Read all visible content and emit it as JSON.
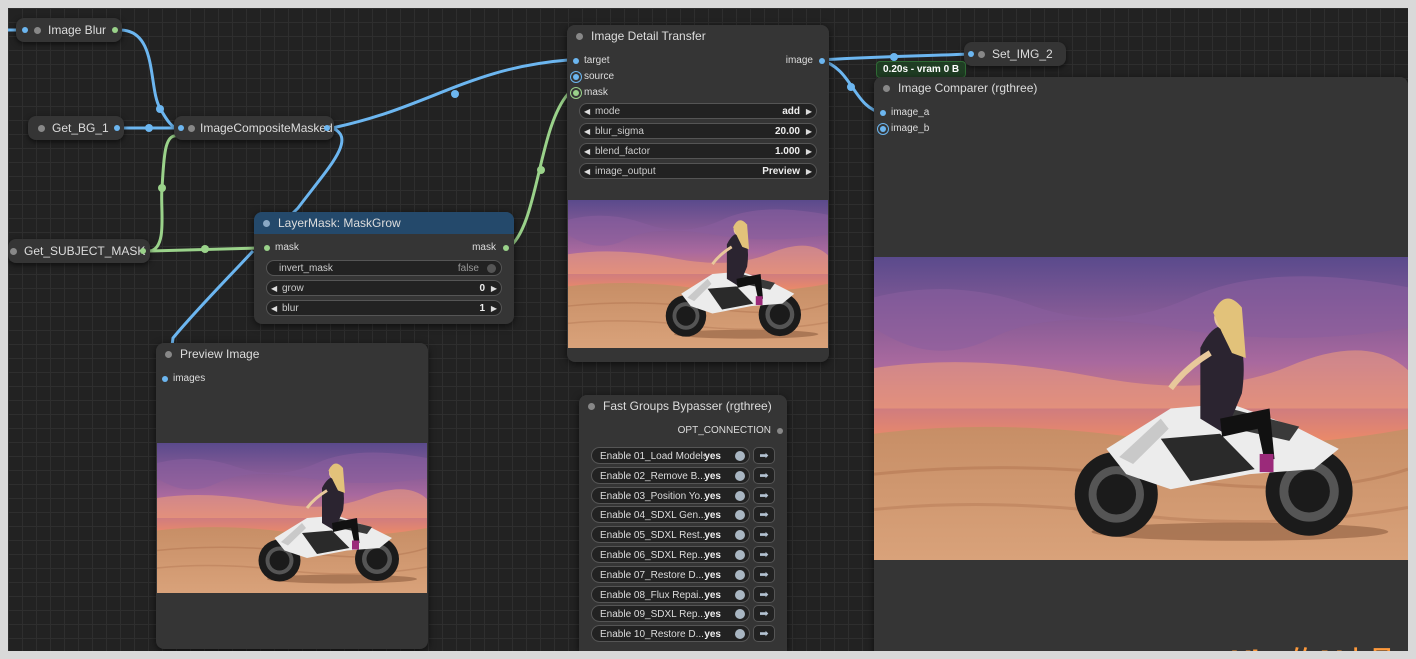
{
  "nodes": {
    "image_blur": {
      "title": "Image Blur"
    },
    "get_bg": {
      "title": "Get_BG_1"
    },
    "get_subject_mask": {
      "title": "Get_SUBJECT_MASK"
    },
    "composite": {
      "title": "ImageCompositeMasked"
    },
    "maskgrow": {
      "title": "LayerMask: MaskGrow",
      "input": "mask",
      "output": "mask",
      "invert_label": "invert_mask",
      "invert_value": "false",
      "grow_label": "grow",
      "grow_value": "0",
      "blur_label": "blur",
      "blur_value": "1"
    },
    "preview": {
      "title": "Preview Image",
      "input": "images"
    },
    "detail": {
      "title": "Image Detail Transfer",
      "inputs": [
        "target",
        "source",
        "mask"
      ],
      "output": "image",
      "widgets": [
        {
          "label": "mode",
          "value": "add"
        },
        {
          "label": "blur_sigma",
          "value": "20.00"
        },
        {
          "label": "blend_factor",
          "value": "1.000"
        },
        {
          "label": "image_output",
          "value": "Preview"
        }
      ]
    },
    "set_img": {
      "title": "Set_IMG_2"
    },
    "comparer": {
      "title": "Image Comparer (rgthree)",
      "inputs": [
        "image_a",
        "image_b"
      ]
    },
    "bypasser": {
      "title": "Fast Groups Bypasser (rgthree)",
      "output": "OPT_CONNECTION",
      "rows": [
        {
          "label": "Enable 01_Load Models",
          "value": "yes"
        },
        {
          "label": "Enable 02_Remove B...",
          "value": "yes"
        },
        {
          "label": "Enable 03_Position Yo...",
          "value": "yes"
        },
        {
          "label": "Enable 04_SDXL Gen...",
          "value": "yes"
        },
        {
          "label": "Enable 05_SDXL Rest...",
          "value": "yes"
        },
        {
          "label": "Enable 06_SDXL Rep...",
          "value": "yes"
        },
        {
          "label": "Enable 07_Restore D...",
          "value": "yes"
        },
        {
          "label": "Enable 08_Flux Repai...",
          "value": "yes"
        },
        {
          "label": "Enable 09_SDXL Rep...",
          "value": "yes"
        },
        {
          "label": "Enable 10_Restore D...",
          "value": "yes"
        }
      ]
    }
  },
  "status_badge": "0.20s - vram 0 B",
  "watermark": "Vito的AI力量",
  "colors": {
    "image_wire": "#6cb6f0",
    "mask_wire": "#9ad28a",
    "node_bg": "#353535",
    "maskgrow_header": "#24496b",
    "badge_bg": "#1f3d23",
    "watermark": "#ff9a3c"
  }
}
